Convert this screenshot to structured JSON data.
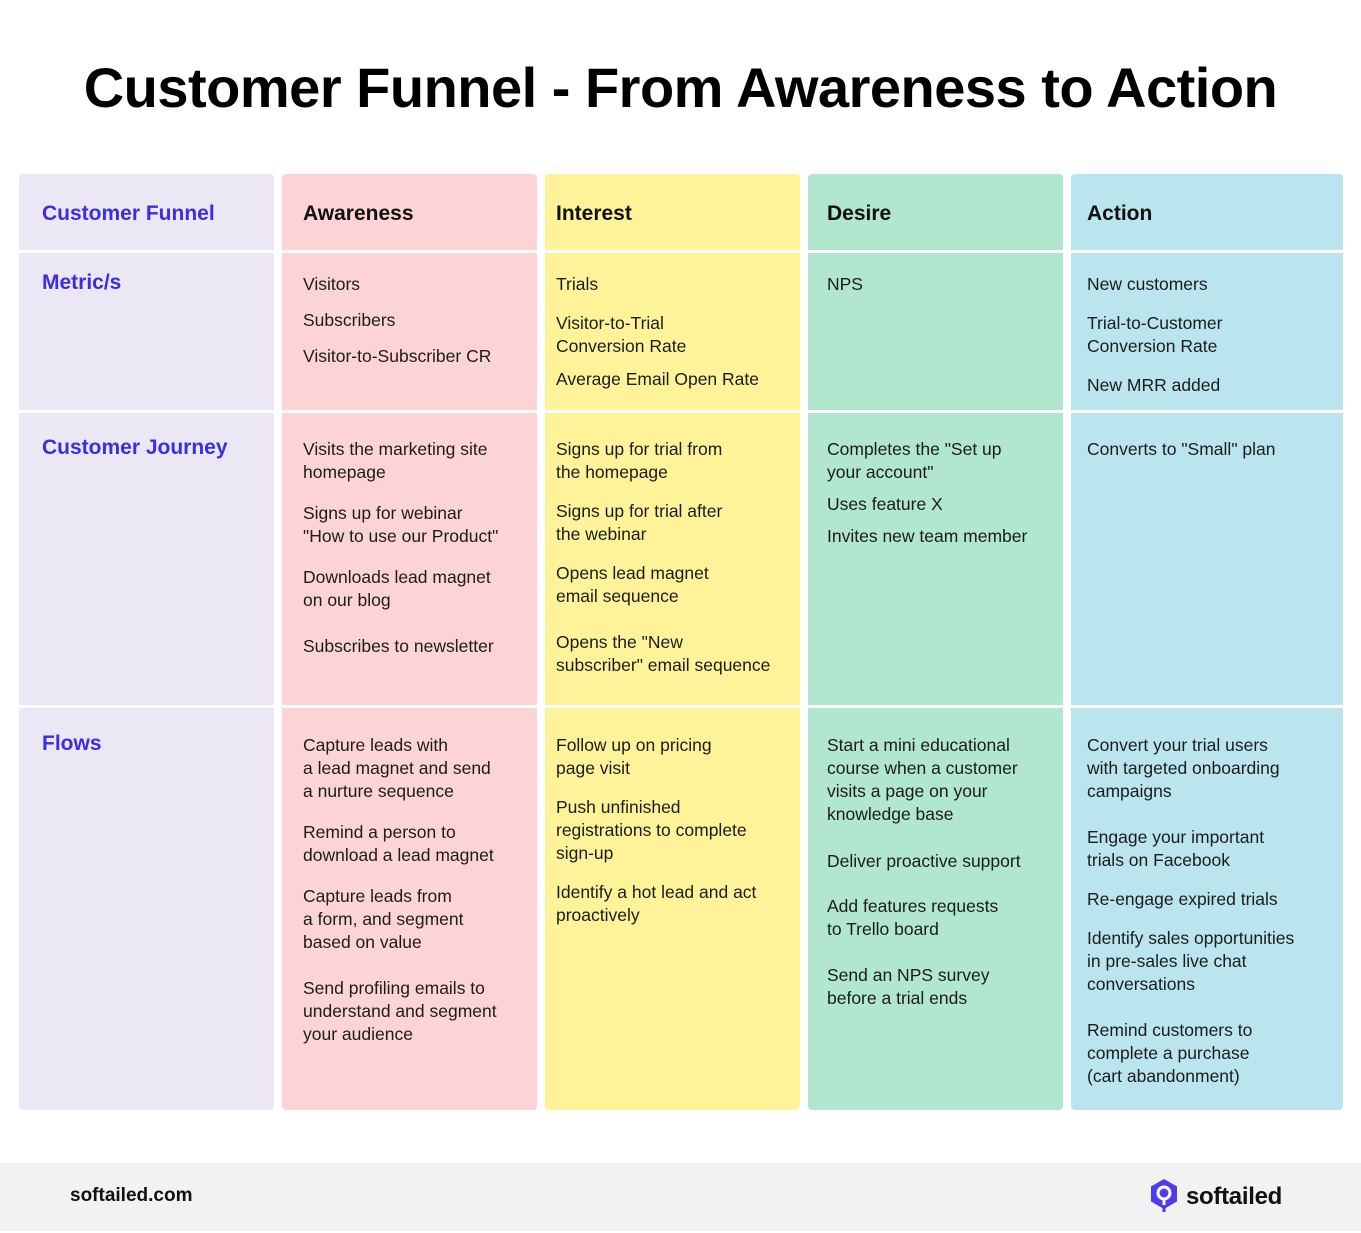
{
  "title": "Customer Funnel - From Awareness to Action",
  "colors": {
    "label_column": "#ebe7f4",
    "awareness": "#fdd4d5",
    "interest": "#fef399",
    "desire": "#b1e6cf",
    "action": "#bae4ee",
    "label_text": "#3b2ee0",
    "footer_bg": "#f2f2f2",
    "brand": "#4f3cf0"
  },
  "row_labels": {
    "header": "Customer Funnel",
    "metrics": "Metric/s",
    "journey": "Customer Journey",
    "flows": "Flows"
  },
  "stages": [
    {
      "name": "Awareness",
      "metrics": [
        "Visitors",
        "Subscribers",
        "Visitor-to-Subscriber CR"
      ],
      "journey": [
        "Visits the marketing site\nhomepage",
        "Signs up for webinar\n\"How to use our Product\"",
        "Downloads lead magnet\non our blog",
        "Subscribes to newsletter"
      ],
      "flows": [
        "Capture leads with\na lead magnet and send\na nurture sequence",
        "Remind a person to\ndownload a lead magnet",
        "Capture leads from\na form, and segment\nbased on value",
        "Send profiling emails to\nunderstand and segment\nyour audience"
      ]
    },
    {
      "name": "Interest",
      "metrics": [
        "Trials",
        "Visitor-to-Trial\nConversion Rate",
        "Average Email Open Rate"
      ],
      "journey": [
        "Signs up for trial from\nthe homepage",
        "Signs up for trial after\nthe webinar",
        "Opens lead magnet\nemail sequence",
        "Opens the \"New\nsubscriber\" email sequence"
      ],
      "flows": [
        "Follow up on pricing\npage visit",
        "Push unfinished\nregistrations to complete\nsign-up",
        "Identify a hot lead and act\nproactively"
      ]
    },
    {
      "name": "Desire",
      "metrics": [
        "NPS"
      ],
      "journey": [
        "Completes the \"Set up\nyour account\"",
        "Uses feature X",
        "Invites new team member"
      ],
      "flows": [
        "Start a mini educational\ncourse when a customer\nvisits a page on your\nknowledge base",
        "Deliver proactive support",
        "Add features requests\nto Trello board",
        "Send an NPS survey\nbefore a trial ends"
      ]
    },
    {
      "name": "Action",
      "metrics": [
        "New customers",
        "Trial-to-Customer\nConversion Rate",
        "New MRR added"
      ],
      "journey": [
        "Converts to \"Small\" plan"
      ],
      "flows": [
        "Convert your trial users\nwith targeted onboarding\ncampaigns",
        "Engage your important\ntrials on Facebook",
        "Re-engage expired trials",
        "Identify sales opportunities\nin pre-sales live chat\nconversations",
        "Remind customers to\ncomplete a purchase\n(cart abandonment)"
      ]
    }
  ],
  "footer": {
    "url": "softailed.com",
    "brand_name": "softailed",
    "brand_icon": "hexagon-search-logo-icon"
  }
}
